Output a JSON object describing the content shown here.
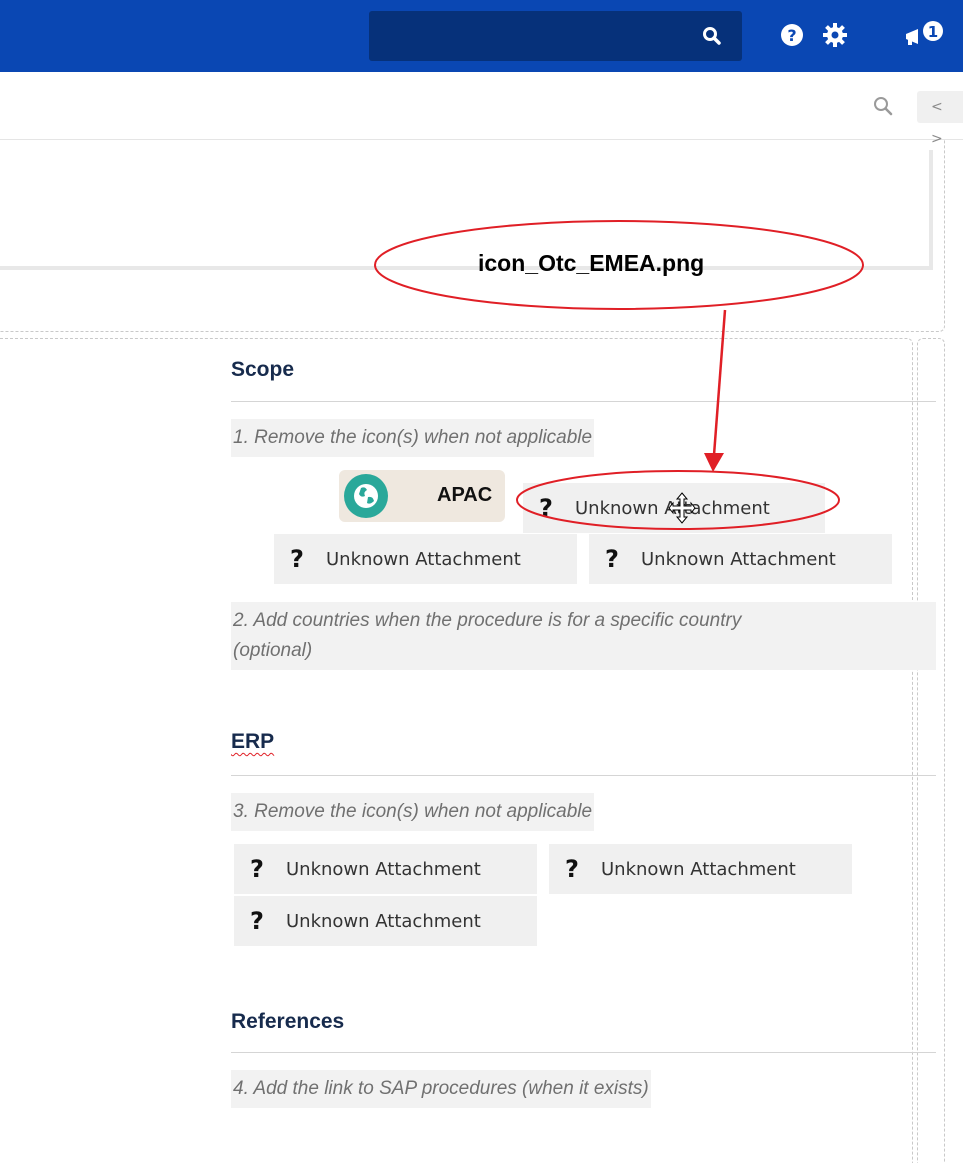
{
  "topbar": {
    "search_icon": "search-icon",
    "help_icon": "help-icon",
    "settings_icon": "gear-icon",
    "notification_icon": "megaphone-icon",
    "notification_count": "1",
    "colors": {
      "bar": "#0a47b3",
      "search_bg": "#06317a"
    }
  },
  "toolbar": {
    "search_icon": "search-icon",
    "code_toggle_label": "< >"
  },
  "annotation": {
    "label": "icon_Otc_EMEA.png",
    "color": "#e01f26"
  },
  "sections": {
    "scope": {
      "title": "Scope",
      "instruction_1": "1. Remove the icon(s) when not applicable",
      "apac_label": "APAC",
      "attachments": [
        "Unknown Attachment",
        "Unknown Attachment",
        "Unknown Attachment"
      ],
      "instruction_2_line1": "2. Add countries when the procedure is for a specific country",
      "instruction_2_line2": "(optional)"
    },
    "erp": {
      "title": "ERP",
      "instruction": "3. Remove the icon(s) when not applicable",
      "attachments": [
        "Unknown Attachment",
        "Unknown Attachment",
        "Unknown Attachment"
      ]
    },
    "references": {
      "title": "References",
      "instruction": "4. Add the link to SAP procedures (when it exists)"
    }
  },
  "attachment_glyph": "?"
}
